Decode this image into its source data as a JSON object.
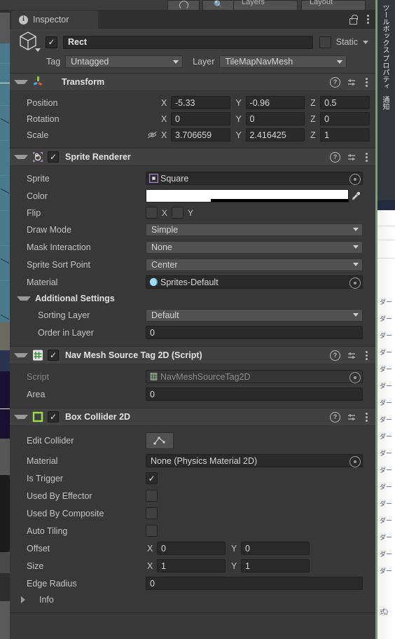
{
  "window": {
    "tab_label": "Inspector",
    "info_glyph": "i",
    "lock_icon": "lock-icon",
    "menu_icon": "kebab-menu-icon"
  },
  "toolbar": {
    "layers_label": "Layers",
    "layout_label": "Layout"
  },
  "gameobject": {
    "enabled": true,
    "name": "Rect",
    "static_label": "Static",
    "static_checked": false,
    "tag_label": "Tag",
    "tag_value": "Untagged",
    "layer_label": "Layer",
    "layer_value": "TileMapNavMesh"
  },
  "components": [
    {
      "title": "Transform",
      "icon": "transform-icon",
      "has_enable_toggle": false,
      "expanded": true,
      "rows": [
        {
          "kind": "vector3",
          "label": "Position",
          "x": "-5.33",
          "y": "-0.96",
          "z": "0.5"
        },
        {
          "kind": "vector3",
          "label": "Rotation",
          "x": "0",
          "y": "0",
          "z": "0"
        },
        {
          "kind": "vector3",
          "label": "Scale",
          "x": "3.706659",
          "y": "2.416425",
          "z": "1",
          "link_icon": "constrain-proportions-off-icon"
        }
      ]
    },
    {
      "title": "Sprite Renderer",
      "icon": "sprite-renderer-icon",
      "has_enable_toggle": true,
      "enabled": true,
      "expanded": true,
      "rows": [
        {
          "kind": "object",
          "label": "Sprite",
          "value": "Square",
          "thumb": "sprite-asset-icon"
        },
        {
          "kind": "color",
          "label": "Color",
          "value": "#FFFFFF",
          "alpha": 0.32
        },
        {
          "kind": "flip",
          "label": "Flip",
          "x_label": "X",
          "y_label": "Y",
          "x_checked": false,
          "y_checked": false
        },
        {
          "kind": "dropdown",
          "label": "Draw Mode",
          "value": "Simple"
        },
        {
          "kind": "dropdown",
          "label": "Mask Interaction",
          "value": "None"
        },
        {
          "kind": "dropdown",
          "label": "Sprite Sort Point",
          "value": "Center"
        },
        {
          "kind": "object",
          "label": "Material",
          "value": "Sprites-Default",
          "thumb": "material-asset-icon"
        },
        {
          "kind": "header",
          "label": "Additional Settings"
        },
        {
          "kind": "dropdown",
          "label": "Sorting Layer",
          "value": "Default",
          "indent": true
        },
        {
          "kind": "text",
          "label": "Order in Layer",
          "value": "0",
          "indent": true
        }
      ]
    },
    {
      "title": "Nav Mesh Source Tag 2D (Script)",
      "icon": "script-icon",
      "has_enable_toggle": true,
      "enabled": true,
      "expanded": true,
      "rows": [
        {
          "kind": "object",
          "label": "Script",
          "value": "NavMeshSourceTag2D",
          "thumb": "script-asset-icon",
          "disabled": true
        },
        {
          "kind": "text",
          "label": "Area",
          "value": "0"
        }
      ]
    },
    {
      "title": "Box Collider 2D",
      "icon": "box-collider-2d-icon",
      "has_enable_toggle": true,
      "enabled": true,
      "expanded": true,
      "rows": [
        {
          "kind": "button",
          "label": "Edit Collider",
          "button_icon": "edit-collider-icon"
        },
        {
          "kind": "object_plain",
          "label": "Material",
          "value": "None (Physics Material 2D)"
        },
        {
          "kind": "checkbox",
          "label": "Is Trigger",
          "checked": true
        },
        {
          "kind": "checkbox",
          "label": "Used By Effector",
          "checked": false
        },
        {
          "kind": "checkbox",
          "label": "Used By Composite",
          "checked": false
        },
        {
          "kind": "checkbox",
          "label": "Auto Tiling",
          "checked": false
        },
        {
          "kind": "vector2",
          "label": "Offset",
          "x": "0",
          "y": "0"
        },
        {
          "kind": "vector2",
          "label": "Size",
          "x": "1",
          "y": "1"
        },
        {
          "kind": "text",
          "label": "Edge Radius",
          "value": "0"
        },
        {
          "kind": "foldout",
          "label": "Info",
          "expanded": false
        }
      ]
    }
  ],
  "right_panel": {
    "vertical_tabs": [
      "ツールボックス",
      "プロパティ",
      "通知"
    ],
    "list_items": [
      "ダー",
      "ダー",
      "ダー",
      "ダー",
      "ダー",
      "ダー",
      "ダー",
      "ダー",
      "ダー",
      "ダー",
      "ダー",
      "ダー",
      "ダー",
      "ダー",
      "ダー",
      "ダー",
      "ダー"
    ],
    "footer_text": "式)"
  },
  "colors": {
    "panel_bg": "#383838",
    "header_bg": "#414141",
    "field_bg": "#2a2a2a",
    "dropdown_bg": "#515151",
    "text": "#c4c4c4",
    "collider_green": "#97e03d",
    "sprite_purple": "#b07fd8",
    "scene_teal": "#4a7b8c"
  }
}
